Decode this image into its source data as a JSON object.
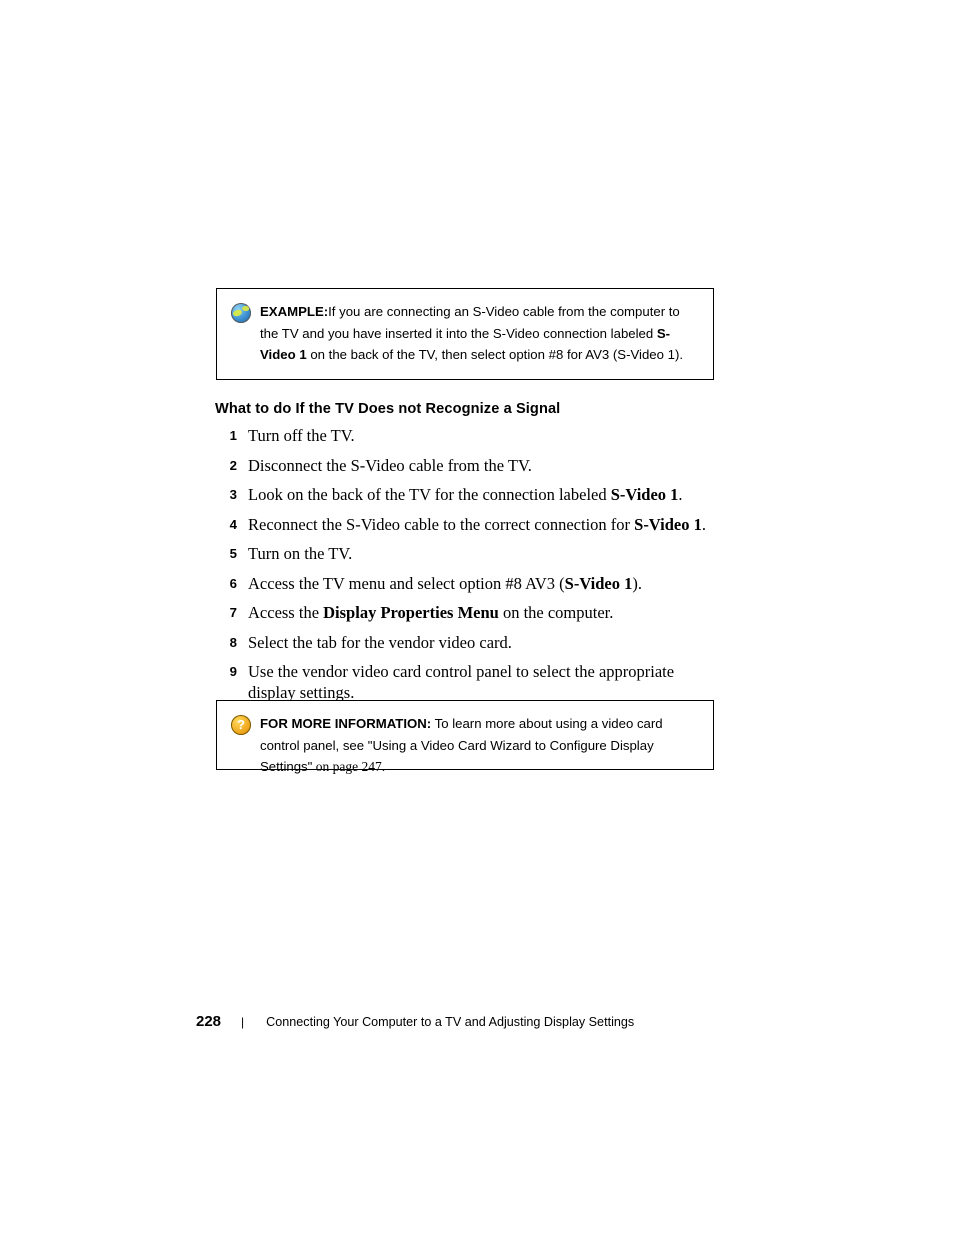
{
  "document": {
    "example_callout": {
      "icon": "globe-icon",
      "label": "EXAMPLE:",
      "body_part1": "If you are connecting an S-Video cable from the computer to the TV and you have inserted it into the S-Video connection labeled ",
      "body_bold": "S-Video 1",
      "body_part2": " on the back of the TV, then select option #8 for AV3 (S-Video 1)."
    },
    "heading": "What to do If the TV Does not Recognize a Signal",
    "steps": [
      {
        "num": "1",
        "text": "Turn off the TV."
      },
      {
        "num": "2",
        "text": "Disconnect the S-Video cable from the TV."
      },
      {
        "num": "3",
        "text_pre": "Look on the back of the TV for the connection labeled ",
        "bold": "S-Video 1",
        "text_post": "."
      },
      {
        "num": "4",
        "text_pre": "Reconnect the S-Video cable to the correct connection for ",
        "bold": "S-Video 1",
        "text_post": "."
      },
      {
        "num": "5",
        "text": "Turn on the TV."
      },
      {
        "num": "6",
        "text_pre": "Access the TV menu and select option #8 AV3 (",
        "bold": "S-Video 1",
        "text_post": ")."
      },
      {
        "num": "7",
        "text_pre": "Access the ",
        "bold": "Display Properties Menu",
        "text_post": " on the computer."
      },
      {
        "num": "8",
        "text": "Select the tab for the vendor video card."
      },
      {
        "num": "9",
        "text": "Use the vendor video card control panel to select the appropriate display settings."
      }
    ],
    "info_callout": {
      "icon": "question-mark-icon",
      "label": "FOR MORE INFORMATION:",
      "body": " To learn more about using a video card control panel, see \"Using a Video Card Wizard to Configure Display Settings\"",
      "page_ref": " on page 247."
    },
    "footer": {
      "page_number": "228",
      "separator": "|",
      "title": "Connecting Your Computer to a TV and Adjusting Display Settings"
    }
  }
}
